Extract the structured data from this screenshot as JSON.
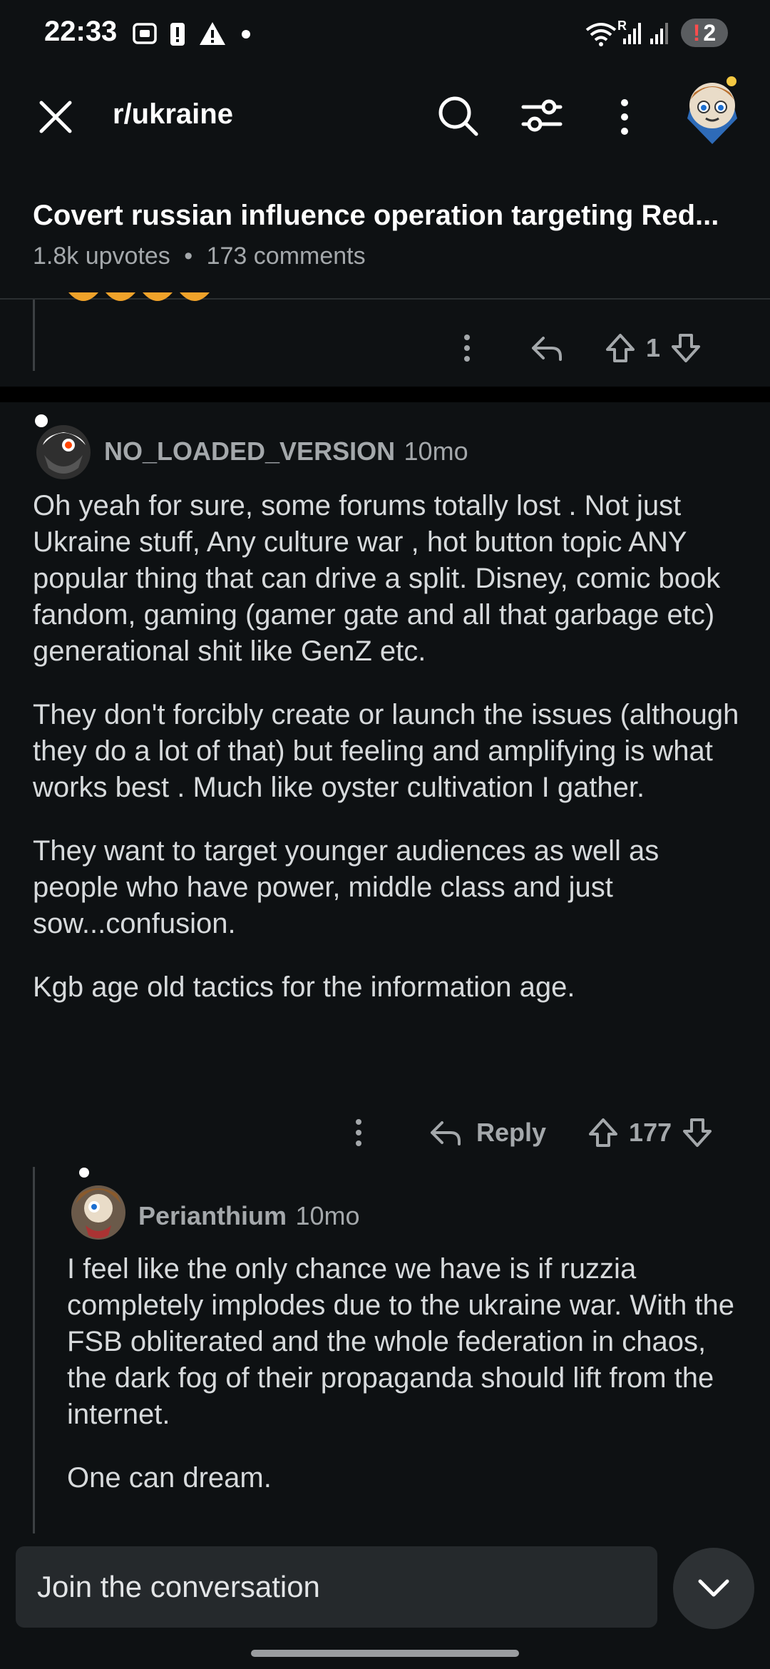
{
  "status_bar": {
    "time": "22:33",
    "badge_count": "2",
    "badge_alert": "!",
    "network_label": "R"
  },
  "header": {
    "subreddit": "r/ukraine",
    "close_icon": "close-icon",
    "search_icon": "search-icon",
    "filter_icon": "sort-filter-icon",
    "more_icon": "more-vertical-icon"
  },
  "post": {
    "title": "Covert russian influence operation targeting Red...",
    "upvotes": "1.8k upvotes",
    "separator": "•",
    "comments": "173 comments"
  },
  "prev_comment": {
    "vote_count": "1"
  },
  "comment1": {
    "username": "NO_LOADED_VERSION",
    "age": "10mo",
    "paragraphs": [
      "Oh yeah for sure, some forums totally lost . Not just Ukraine stuff, Any culture war , hot button topic ANY popular thing that can drive a split. Disney, comic book fandom, gaming (gamer gate and all that garbage etc) generational shit like GenZ etc.",
      "They don't forcibly create or launch the issues (although they do a lot of that) but feeling and amplifying is what works best . Much like oyster cultivation I gather.",
      "They want to target younger audiences as well as people who have power, middle class and just sow...confusion.",
      "Kgb age old tactics for the information age."
    ],
    "reply_label": "Reply",
    "vote_count": "177"
  },
  "comment2": {
    "username": "Perianthium",
    "age": "10mo",
    "paragraphs": [
      "I feel like the only chance we have is if ruzzia completely implodes due to the ukraine war. With the FSB obliterated and the whole federation in chaos, the dark fog of their propaganda should lift from the internet.",
      "One can dream."
    ]
  },
  "composer": {
    "placeholder": "Join the conversation"
  },
  "colors": {
    "background": "#0e1113",
    "text": "#d7dadc",
    "muted": "#a4a8ab",
    "input_bg": "#25292c"
  }
}
